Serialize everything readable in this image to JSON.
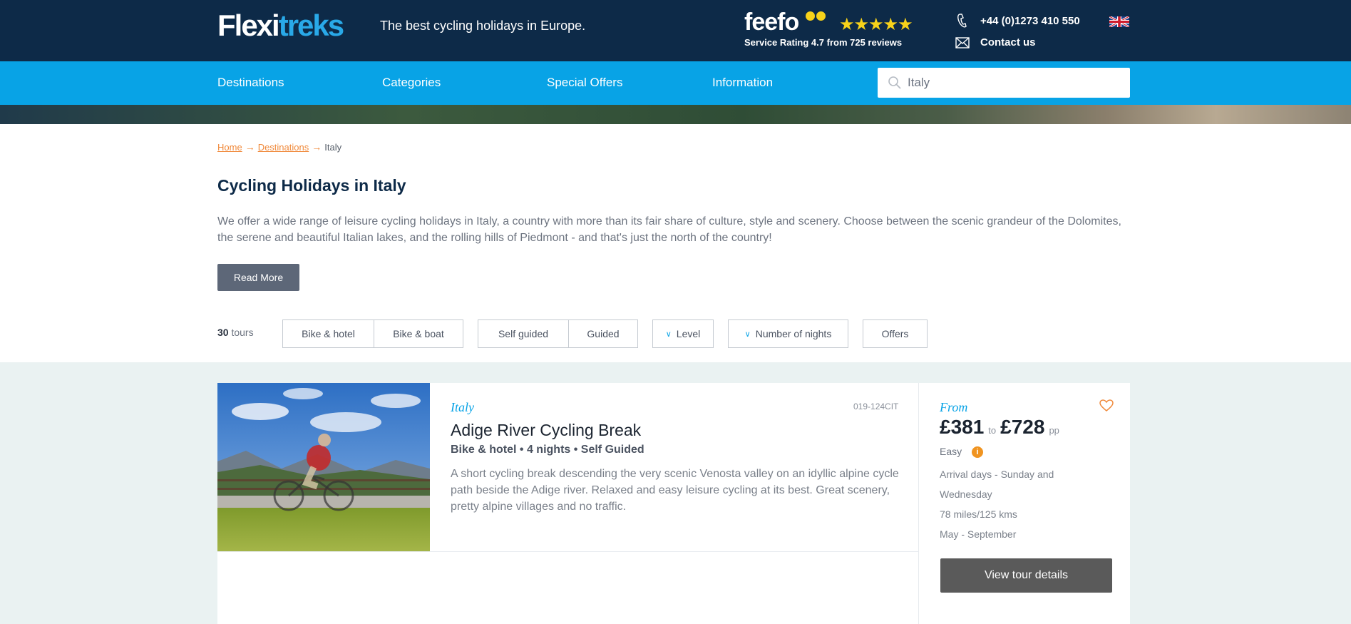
{
  "header": {
    "logo_part1": "Flexi",
    "logo_part2": "treks",
    "tagline": "The best cycling holidays in Europe.",
    "feefo_word": "feefo",
    "stars": "★★★★★",
    "rating_text": "Service Rating 4.7 from 725 reviews",
    "phone": "+44 (0)1273 410 550",
    "contact_label": "Contact us"
  },
  "nav": {
    "items": [
      "Destinations",
      "Categories",
      "Special Offers",
      "Information"
    ],
    "search_value": "Italy"
  },
  "breadcrumb": {
    "home": "Home",
    "destinations": "Destinations",
    "current": "Italy"
  },
  "page": {
    "title": "Cycling Holidays in Italy",
    "intro": "We offer a wide range of leisure cycling holidays in Italy, a country with more than its fair share of culture, style and scenery. Choose between the scenic grandeur of the Dolomites, the serene and beautiful Italian lakes, and the rolling hills of Piedmont - and that's just the north of the country!",
    "read_more": "Read More"
  },
  "filters": {
    "count": "30",
    "count_label": "tours",
    "bike_hotel": "Bike & hotel",
    "bike_boat": "Bike & boat",
    "self_guided": "Self guided",
    "guided": "Guided",
    "level": "Level",
    "nights": "Number of nights",
    "offers": "Offers"
  },
  "tour": {
    "country": "Italy",
    "code": "019-124CIT",
    "title": "Adige River Cycling Break",
    "meta": "Bike & hotel • 4 nights • Self Guided",
    "description": "A short cycling break descending the very scenic Venosta valley on an idyllic alpine cycle path beside the Adige river. Relaxed and easy leisure cycling at its best. Great scenery, pretty alpine villages and no traffic.",
    "from_label": "From",
    "price_from": "£381",
    "price_to_label": "to",
    "price_to": "£728",
    "pp": "pp",
    "level": "Easy",
    "arrival": "Arrival days - Sunday and Wednesday",
    "distance": "78 miles/125 kms",
    "season": "May - September",
    "view_button": "View tour details"
  },
  "colors": {
    "header_bg": "#0d2a48",
    "nav_bg": "#08a3e6",
    "accent_orange": "#f0893a",
    "button_grey": "#5d6778"
  }
}
